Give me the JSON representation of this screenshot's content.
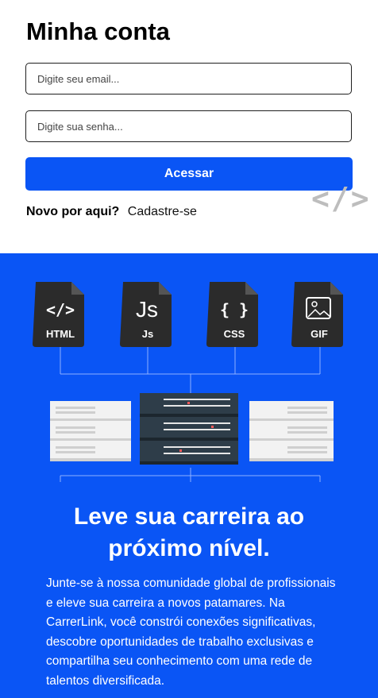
{
  "login": {
    "title": "Minha conta",
    "email_placeholder": "Digite seu email...",
    "password_placeholder": "Digite sua senha...",
    "submit_label": "Acessar",
    "new_here": "Novo por aqui?",
    "signup_link": "Cadastre-se",
    "decor_code": "</>"
  },
  "hero": {
    "file_icons": [
      {
        "glyph": "</>",
        "label": "HTML"
      },
      {
        "glyph": "Js",
        "label": "Js"
      },
      {
        "glyph": "{ }",
        "label": "CSS"
      },
      {
        "glyph": "image",
        "label": "GIF"
      }
    ],
    "headline_line1": "Leve sua carreira ao",
    "headline_line2": "próximo nível.",
    "description": "Junte-se à nossa comunidade global de profissionais e eleve sua carreira a novos patamares. Na CarrerLink, você constrói conexões significativas, descobre oportunidades de trabalho exclusivas e compartilha seu conhecimento com uma rede de talentos diversificada."
  },
  "colors": {
    "accent": "#0a55f5",
    "dark_icon": "#2b2b2b",
    "white": "#ffffff"
  }
}
